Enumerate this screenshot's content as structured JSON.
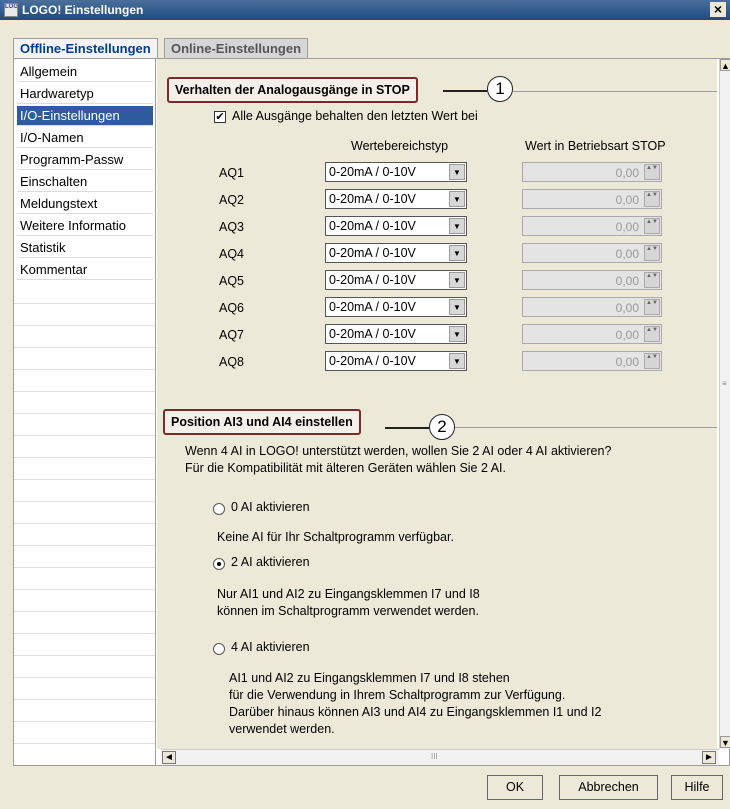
{
  "window": {
    "title": "LOGO! Einstellungen",
    "logo_text": "LOGO",
    "close_glyph": "×"
  },
  "tabs": [
    {
      "label": "Offline-Einstellungen",
      "active": true
    },
    {
      "label": "Online-Einstellungen",
      "active": false
    }
  ],
  "sidebar": {
    "items": [
      {
        "label": "Allgemein"
      },
      {
        "label": "Hardwaretyp"
      },
      {
        "label": "I/O-Einstellungen",
        "selected": true
      },
      {
        "label": "I/O-Namen"
      },
      {
        "label": "Programm-Passw"
      },
      {
        "label": "Einschalten"
      },
      {
        "label": "Meldungstext"
      },
      {
        "label": "Weitere Informatio"
      },
      {
        "label": "Statistik"
      },
      {
        "label": "Kommentar"
      }
    ]
  },
  "section1": {
    "title": "Verhalten der Analogausgänge in STOP",
    "callout": "1",
    "checkbox_label": "Alle Ausgänge behalten den letzten Wert bei",
    "checkbox_checked": true,
    "col_range": "Wertebereichstyp",
    "col_stop": "Wert in Betriebsart STOP",
    "rows": [
      {
        "name": "AQ1",
        "range": "0-20mA / 0-10V",
        "value": "0,00"
      },
      {
        "name": "AQ2",
        "range": "0-20mA / 0-10V",
        "value": "0,00"
      },
      {
        "name": "AQ3",
        "range": "0-20mA / 0-10V",
        "value": "0,00"
      },
      {
        "name": "AQ4",
        "range": "0-20mA / 0-10V",
        "value": "0,00"
      },
      {
        "name": "AQ5",
        "range": "0-20mA / 0-10V",
        "value": "0,00"
      },
      {
        "name": "AQ6",
        "range": "0-20mA / 0-10V",
        "value": "0,00"
      },
      {
        "name": "AQ7",
        "range": "0-20mA / 0-10V",
        "value": "0,00"
      },
      {
        "name": "AQ8",
        "range": "0-20mA / 0-10V",
        "value": "0,00"
      }
    ]
  },
  "section2": {
    "title": "Position AI3 und AI4 einstellen",
    "callout": "2",
    "intro_line1": "Wenn 4 AI in LOGO! unterstützt werden, wollen Sie 2 AI oder 4 AI aktivieren?",
    "intro_line2": "Für die Kompatibilität mit älteren Geräten wählen Sie 2 AI.",
    "options": [
      {
        "label": "0 AI aktivieren",
        "selected": false,
        "desc": [
          "Keine AI für Ihr Schaltprogramm verfügbar."
        ]
      },
      {
        "label": "2 AI aktivieren",
        "selected": true,
        "desc": [
          "Nur AI1 und AI2 zu Eingangsklemmen I7 und I8",
          " können im Schaltprogramm verwendet werden."
        ]
      },
      {
        "label": "4 AI aktivieren",
        "selected": false,
        "desc": [
          "AI1 und AI2 zu Eingangsklemmen I7 und I8 stehen",
          "für die Verwendung in Ihrem Schaltprogramm zur Verfügung.",
          "Darüber hinaus können AI3 und AI4 zu Eingangsklemmen I1 und I2",
          "verwendet werden."
        ]
      }
    ]
  },
  "buttons": {
    "ok": "OK",
    "cancel": "Abbrechen",
    "help": "Hilfe"
  },
  "scroll_glyphs": {
    "up": "▲",
    "down": "▼",
    "left": "◄",
    "right": "►",
    "dropdown": "▼",
    "spin": "▲▼",
    "check": "✔",
    "grip": "III"
  }
}
